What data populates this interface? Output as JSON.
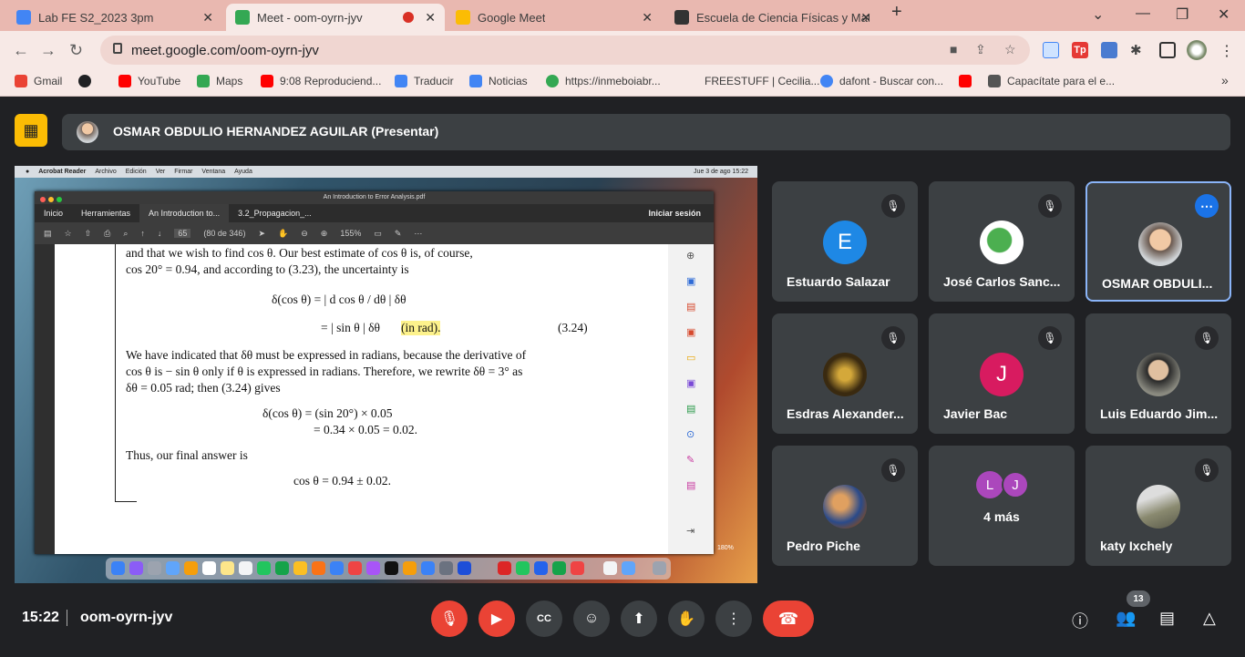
{
  "browser": {
    "tabs": [
      {
        "title": "Lab FE S2_2023 3pm",
        "color": "#4285f4"
      },
      {
        "title": "Meet - oom-oyrn-jyv",
        "color": "#34a853"
      },
      {
        "title": "Google Meet",
        "color": "#fbbc04"
      },
      {
        "title": "Escuela de Ciencia Físicas y Mate",
        "color": "#333333"
      }
    ],
    "new_tab": "+",
    "url": "meet.google.com/oom-oyrn-jyv",
    "bookmarks": [
      {
        "label": "Gmail",
        "color": "#ea4335"
      },
      {
        "label": "",
        "color": "#202124"
      },
      {
        "label": "YouTube",
        "color": "#ff0000"
      },
      {
        "label": "Maps",
        "color": "#34a853"
      },
      {
        "label": "9:08 Reproduciend...",
        "color": "#ff0000"
      },
      {
        "label": "Traducir",
        "color": "#4285f4"
      },
      {
        "label": "Noticias",
        "color": "#4285f4"
      },
      {
        "label": "https://inmeboiabr...",
        "color": "#34a853"
      },
      {
        "label": "FREESTUFF | Cecilia...",
        "color": "#f7e9e6"
      },
      {
        "label": "dafont - Buscar con...",
        "color": "#4285f4"
      },
      {
        "label": "",
        "color": "#ff0000"
      },
      {
        "label": "Capacítate para el e...",
        "color": "#555555"
      }
    ],
    "more": "»"
  },
  "meet": {
    "presenter": "OSMAR OBDULIO HERNANDEZ AGUILAR (Presentar)",
    "time": "15:22",
    "meeting_code": "oom-oyrn-jyv",
    "participant_count": "13",
    "participants": [
      {
        "name": "Estuardo Salazar",
        "initial": "E",
        "color": "#1e88e5"
      },
      {
        "name": "José Carlos Sanc...",
        "initial": "",
        "color": "#ffffff"
      },
      {
        "name": "OSMAR OBDULI...",
        "initial": "",
        "color": "#cfd3d6"
      },
      {
        "name": "Esdras Alexander...",
        "initial": "",
        "color": "#3a2a10"
      },
      {
        "name": "Javier Bac",
        "initial": "J",
        "color": "#d81b60"
      },
      {
        "name": "Luis Eduardo Jim...",
        "initial": "",
        "color": "#8a8a80"
      },
      {
        "name": "Pedro Piche",
        "initial": "",
        "color": "#7a4a2a"
      },
      {
        "name": "4 más",
        "initial": "",
        "color": "#3c4043"
      },
      {
        "name": "katy Ixchely",
        "initial": "",
        "color": "#a0a090"
      }
    ],
    "more_avatars": [
      "L",
      "J"
    ]
  },
  "shared": {
    "mac_menu": [
      "Acrobat Reader",
      "Archivo",
      "Edición",
      "Ver",
      "Firmar",
      "Ventana",
      "Ayuda"
    ],
    "mac_clock": "Jue 3 de ago  15:22",
    "doc_title": "An Introduction to Error Analysis.pdf",
    "acro_tabs": [
      "Inicio",
      "Herramientas",
      "An Introduction to...",
      "3.2_Propagacion_..."
    ],
    "sign_in": "Iniciar sesión",
    "page_num": "65",
    "page_total": "(80 de 346)",
    "zoom": "155%",
    "zoom_small": "180%",
    "lines": [
      "and  that  we  wish  to  find  cos θ.  Our  best  estimate  of  cos θ  is,  of  course,",
      "cos 20°  =  0.94, and according to (3.23), the uncertainty is",
      "δ(cos θ)   =   | d cos θ / dθ |  δθ",
      "=   | sin θ |  δθ",
      "(in rad).",
      "(3.24)",
      "We have indicated that  δθ  must be expressed in radians, because the derivative of",
      "cos θ  is  − sin θ  only if  θ  is expressed in radians. Therefore, we rewrite  δθ = 3°  as",
      "δθ = 0.05 rad; then (3.24) gives",
      "δ(cos θ)   =   (sin 20°) × 0.05",
      "=   0.34 × 0.05   =   0.02.",
      "Thus, our final answer is",
      "cos θ   =   0.94 ± 0.02."
    ]
  },
  "icons": {
    "mic_off": "mic-off-icon",
    "camera_off": "camera-off-icon",
    "captions": "captions-icon",
    "emoji": "emoji-icon",
    "present": "present-icon",
    "raise_hand": "raise-hand-icon",
    "more": "more-vert-icon",
    "hangup": "hangup-icon",
    "info": "info-icon",
    "people": "people-icon",
    "chat": "chat-icon",
    "activities": "activities-icon"
  }
}
